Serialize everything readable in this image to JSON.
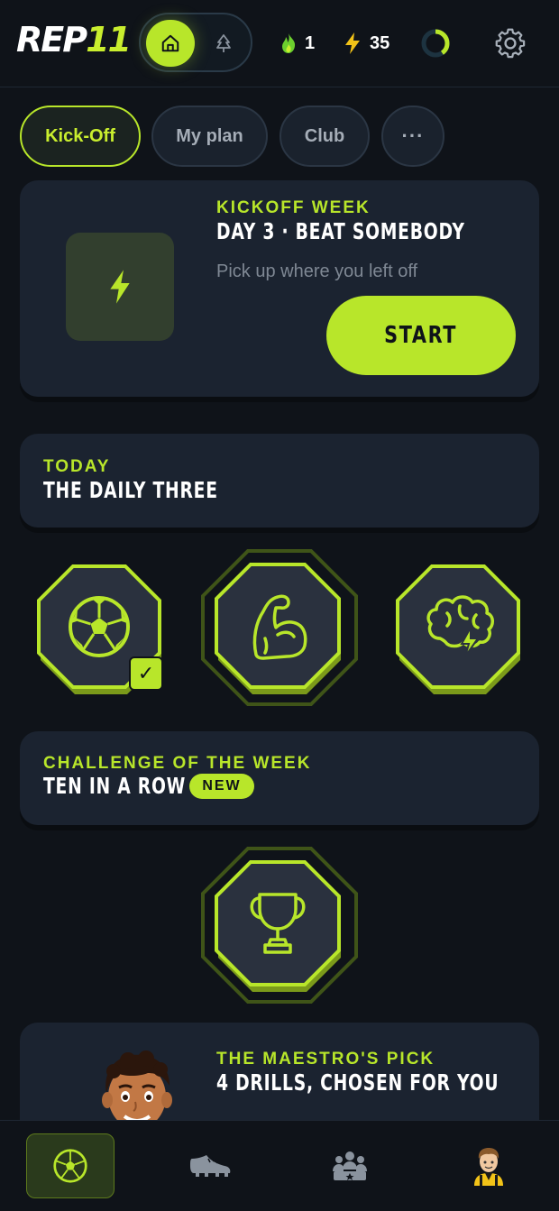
{
  "header": {
    "logo_main": "REP",
    "logo_num": "11",
    "mode_icons": [
      "home-icon",
      "tree-icon"
    ],
    "streak": {
      "icon": "flame-icon",
      "value": "1"
    },
    "energy": {
      "icon": "bolt-icon",
      "value": "35"
    },
    "progress_ring": {
      "icon": "progress-ring-icon",
      "fraction": 0.4
    },
    "settings_icon": "gear-icon"
  },
  "tabs": [
    {
      "label": "Kick-Off",
      "active": true
    },
    {
      "label": "My plan",
      "active": false
    },
    {
      "label": "Club",
      "active": false
    },
    {
      "label": "···",
      "active": false
    }
  ],
  "kickoff": {
    "eyebrow": "KICKOFF WEEK",
    "title": "DAY 3 · BEAT SOMEBODY",
    "subtitle": "Pick up where you left off",
    "button": "START",
    "icon": "bolt-icon"
  },
  "daily": {
    "eyebrow": "TODAY",
    "title": "THE DAILY THREE",
    "items": [
      {
        "icon": "soccer-ball-icon",
        "completed": true,
        "check": "✓"
      },
      {
        "icon": "flexed-arm-icon",
        "completed": false
      },
      {
        "icon": "brain-bolt-icon",
        "completed": false
      }
    ]
  },
  "challenge": {
    "eyebrow": "CHALLENGE OF THE WEEK",
    "title": "TEN IN A ROW",
    "badge": "NEW",
    "icon": "trophy-icon"
  },
  "maestro": {
    "eyebrow": "THE MAESTRO'S PICK",
    "title": "4 DRILLS, CHOSEN FOR YOU",
    "avatar": "maestro-avatar"
  },
  "bottom_nav": [
    {
      "icon": "soccer-ball-icon",
      "active": true
    },
    {
      "icon": "boot-icon",
      "active": false
    },
    {
      "icon": "team-icon",
      "active": false
    },
    {
      "icon": "player-avatar-icon",
      "active": false
    }
  ],
  "colors": {
    "accent": "#b8e62a",
    "background": "#0f1319",
    "card": "#1b2330",
    "muted_text": "#7f8894"
  }
}
